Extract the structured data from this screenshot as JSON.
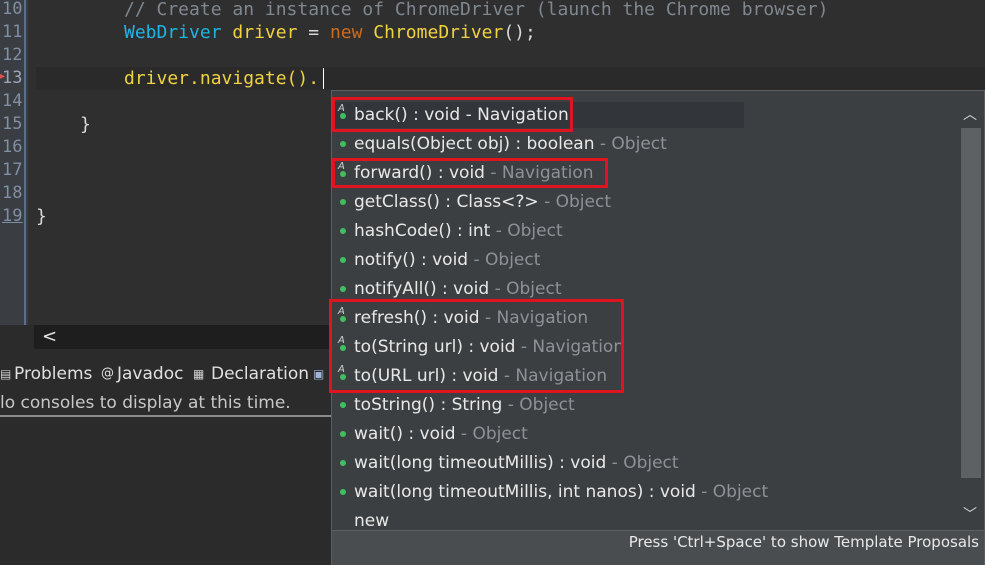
{
  "editor": {
    "line_numbers": [
      "10",
      "11",
      "12",
      "13",
      "14",
      "15",
      "16",
      "17",
      "18",
      "19"
    ],
    "lines": {
      "l10_comment": "// Create an instance of ChromeDriver (launch the Chrome browser)",
      "l11_type": "WebDriver",
      "l11_var": "driver",
      "l11_eq": " = ",
      "l11_kw": "new",
      "l11_ctor": "ChromeDriver",
      "l11_tail": "();",
      "l13_code": "driver.navigate().",
      "l15_brace": "}",
      "l19_brace": "}"
    }
  },
  "hscroll": {
    "arrow": "<"
  },
  "bottom_panel": {
    "tabs": [
      {
        "label": "Problems",
        "icon": "problems-icon"
      },
      {
        "label": "Javadoc",
        "icon": "javadoc-icon",
        "glyph": "@"
      },
      {
        "label": "Declaration",
        "icon": "declaration-icon"
      }
    ],
    "console_message": "lo consoles to display at this time."
  },
  "autocomplete": {
    "items": [
      {
        "sig": "back() : void",
        "src": " - Navigation",
        "kind": "interface"
      },
      {
        "sig": "equals(Object obj) : boolean",
        "src": " - Object",
        "kind": "method"
      },
      {
        "sig": "forward() : void",
        "src": " - Navigation",
        "kind": "interface"
      },
      {
        "sig": "getClass() : Class<?>",
        "src": " - Object",
        "kind": "method"
      },
      {
        "sig": "hashCode() : int",
        "src": " - Object",
        "kind": "method"
      },
      {
        "sig": "notify() : void",
        "src": " - Object",
        "kind": "method"
      },
      {
        "sig": "notifyAll() : void",
        "src": " - Object",
        "kind": "method"
      },
      {
        "sig": "refresh() : void",
        "src": " - Navigation",
        "kind": "interface"
      },
      {
        "sig": "to(String url) : void",
        "src": " - Navigation",
        "kind": "interface"
      },
      {
        "sig": "to(URL url) : void",
        "src": " - Navigation",
        "kind": "interface"
      },
      {
        "sig": "toString() : String",
        "src": " - Object",
        "kind": "method"
      },
      {
        "sig": "wait() : void",
        "src": " - Object",
        "kind": "method"
      },
      {
        "sig": "wait(long timeoutMillis) : void",
        "src": " - Object",
        "kind": "method"
      },
      {
        "sig": "wait(long timeoutMillis, int nanos) : void",
        "src": " - Object",
        "kind": "method"
      },
      {
        "sig": "new",
        "src": "",
        "kind": "template"
      }
    ],
    "footer": "Press 'Ctrl+Space' to show Template Proposals",
    "highlight_color": "#e0141e",
    "method_dot_color": "#3fbf5f"
  }
}
